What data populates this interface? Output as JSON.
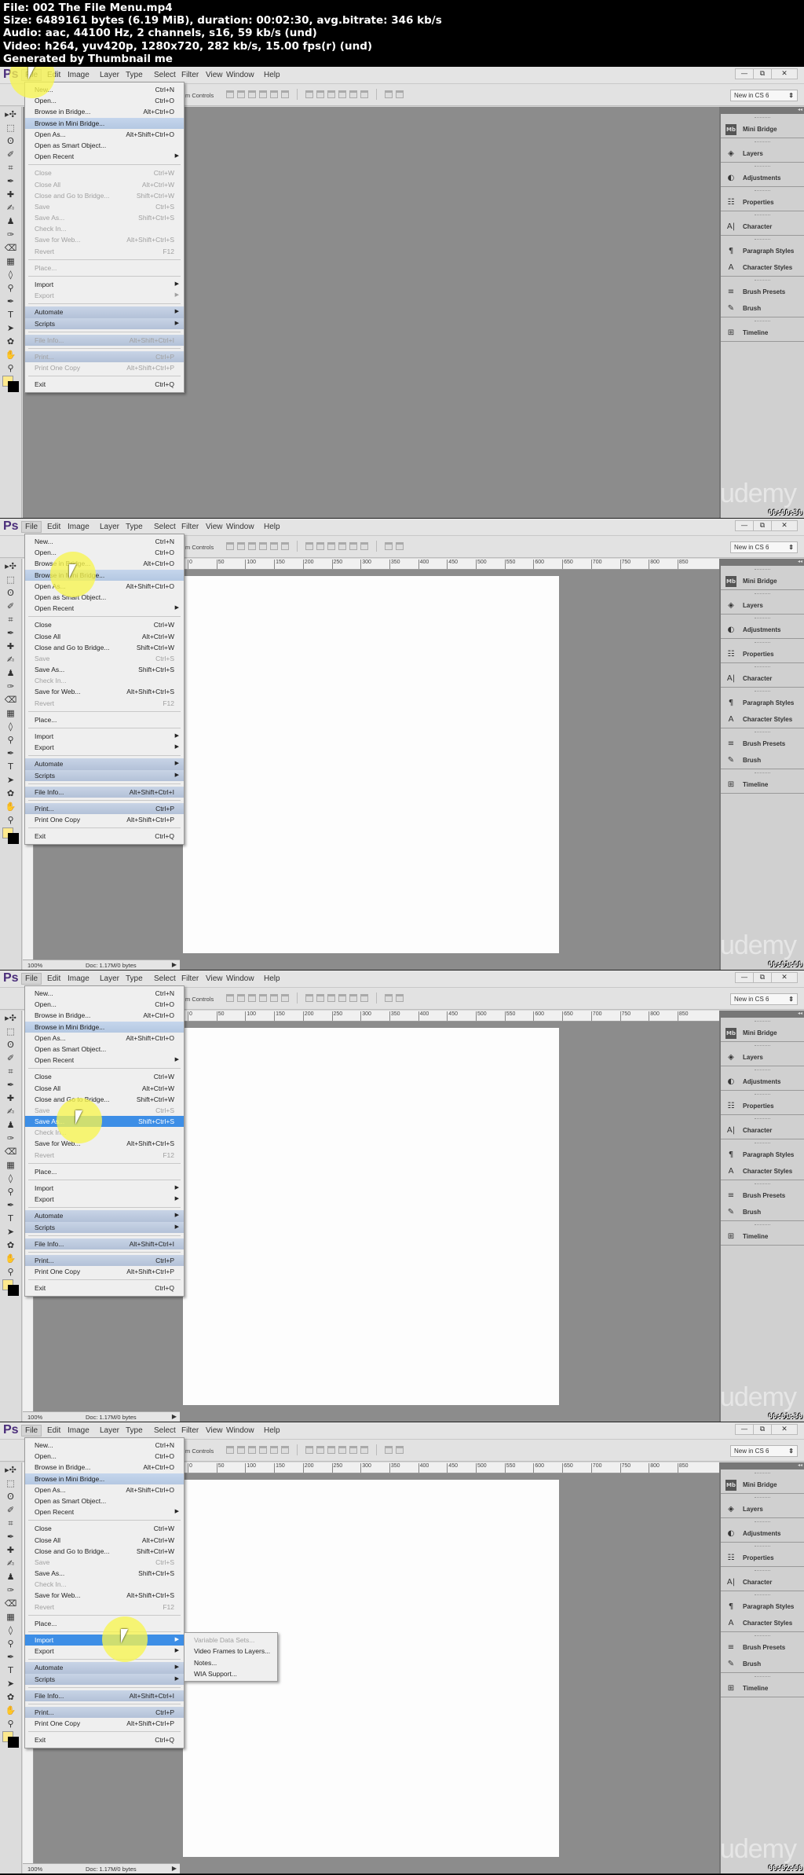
{
  "video_info": {
    "lines": [
      "File: 002 The File Menu.mp4",
      "Size: 6489161 bytes (6.19 MiB), duration: 00:02:30, avg.bitrate: 346 kb/s",
      "Audio: aac, 44100 Hz, 2 channels, s16, 59 kb/s (und)",
      "Video: h264, yuv420p, 1280x720, 282 kb/s, 15.00 fps(r) (und)",
      "Generated by Thumbnail me"
    ]
  },
  "app": {
    "logo": "Ps",
    "menubar": [
      "File",
      "Edit",
      "Image",
      "Layer",
      "Type",
      "Select",
      "Filter",
      "View",
      "Window",
      "Help"
    ],
    "window_controls": {
      "minimize": "—",
      "restore": "⧉",
      "close": "✕"
    },
    "options_label": "m Controls",
    "workspace": "New in CS 6",
    "workspace_arrow": "⇕",
    "dock_collapse": "◂◂",
    "panels": [
      {
        "group": [
          {
            "icon": "Mb",
            "icon_name": "mini-bridge-icon",
            "label": "Mini Bridge"
          }
        ]
      },
      {
        "group": [
          {
            "icon": "◈",
            "icon_name": "layers-icon",
            "label": "Layers"
          }
        ]
      },
      {
        "group": [
          {
            "icon": "◐",
            "icon_name": "adjustments-icon",
            "label": "Adjustments"
          }
        ]
      },
      {
        "group": [
          {
            "icon": "☷",
            "icon_name": "properties-icon",
            "label": "Properties"
          }
        ]
      },
      {
        "group": [
          {
            "icon": "A|",
            "icon_name": "character-icon",
            "label": "Character"
          }
        ]
      },
      {
        "group": [
          {
            "icon": "¶",
            "icon_name": "paragraph-styles-icon",
            "label": "Paragraph Styles"
          },
          {
            "icon": "A",
            "icon_name": "character-styles-icon",
            "label": "Character Styles"
          }
        ]
      },
      {
        "group": [
          {
            "icon": "≡",
            "icon_name": "brush-presets-icon",
            "label": "Brush Presets"
          },
          {
            "icon": "✎",
            "icon_name": "brush-icon",
            "label": "Brush"
          }
        ]
      },
      {
        "group": [
          {
            "icon": "⊞",
            "icon_name": "timeline-icon",
            "label": "Timeline"
          }
        ]
      }
    ],
    "tools": [
      "▸✣",
      "⬚",
      "ʘ",
      "✐",
      "⌗",
      "✒",
      "✚",
      "✍",
      "♟",
      "✑",
      "⌫",
      "▦",
      "◊",
      "⚲",
      "✒",
      "T",
      "➤",
      "✿",
      "✋",
      "⚲"
    ],
    "ruler_ticks": [
      "0",
      "50",
      "100",
      "150",
      "200",
      "250",
      "300",
      "350",
      "400",
      "450",
      "500",
      "550",
      "600",
      "650",
      "700",
      "750",
      "800",
      "850"
    ],
    "status": {
      "zoom": "100%",
      "doc": "Doc: 1.17M/0 bytes",
      "arrow": "▶"
    },
    "watermark": "udemy",
    "submenu_arrow": "▶"
  },
  "file_menu": [
    {
      "label": "New...",
      "shortcut": "Ctrl+N"
    },
    {
      "label": "Open...",
      "shortcut": "Ctrl+O"
    },
    {
      "label": "Browse in Bridge...",
      "shortcut": "Alt+Ctrl+O"
    },
    {
      "label": "Browse in Mini Bridge...",
      "shortcut": ""
    },
    {
      "label": "Open As...",
      "shortcut": "Alt+Shift+Ctrl+O"
    },
    {
      "label": "Open as Smart Object...",
      "shortcut": ""
    },
    {
      "label": "Open Recent",
      "shortcut": "",
      "submenu": true
    },
    {
      "sep": true
    },
    {
      "label": "Close",
      "shortcut": "Ctrl+W"
    },
    {
      "label": "Close All",
      "shortcut": "Alt+Ctrl+W"
    },
    {
      "label": "Close and Go to Bridge...",
      "shortcut": "Shift+Ctrl+W"
    },
    {
      "label": "Save",
      "shortcut": "Ctrl+S"
    },
    {
      "label": "Save As...",
      "shortcut": "Shift+Ctrl+S"
    },
    {
      "label": "Check In...",
      "shortcut": ""
    },
    {
      "label": "Save for Web...",
      "shortcut": "Alt+Shift+Ctrl+S"
    },
    {
      "label": "Revert",
      "shortcut": "F12"
    },
    {
      "sep": true
    },
    {
      "label": "Place...",
      "shortcut": ""
    },
    {
      "sep": true
    },
    {
      "label": "Import",
      "shortcut": "",
      "submenu": true
    },
    {
      "label": "Export",
      "shortcut": "",
      "submenu": true
    },
    {
      "sep": true
    },
    {
      "label": "Automate",
      "shortcut": "",
      "submenu": true
    },
    {
      "label": "Scripts",
      "shortcut": "",
      "submenu": true
    },
    {
      "sep": true
    },
    {
      "label": "File Info...",
      "shortcut": "Alt+Shift+Ctrl+I"
    },
    {
      "sep": true
    },
    {
      "label": "Print...",
      "shortcut": "Ctrl+P"
    },
    {
      "label": "Print One Copy",
      "shortcut": "Alt+Shift+Ctrl+P"
    },
    {
      "sep": true
    },
    {
      "label": "Exit",
      "shortcut": "Ctrl+Q"
    }
  ],
  "import_submenu": [
    {
      "label": "Variable Data Sets...",
      "disabled": true
    },
    {
      "label": "Video Frames to Layers...",
      "disabled": false
    },
    {
      "label": "Notes...",
      "disabled": false
    },
    {
      "label": "WIA Support...",
      "disabled": false
    }
  ],
  "frames": [
    {
      "timestamp": "00:00:30",
      "has_document": false,
      "disabled": [
        "Close",
        "Close All",
        "Close and Go to Bridge...",
        "Save",
        "Save As...",
        "Check In...",
        "Save for Web...",
        "Revert",
        "Place...",
        "Export",
        "File Info...",
        "Print...",
        "Print One Copy"
      ],
      "highlighted": [
        "Browse in Mini Bridge..."
      ],
      "selected": [],
      "group_shaded": [
        "Automate",
        "Scripts",
        "File Info...",
        "Print..."
      ],
      "cursor_near": "File",
      "show_import_submenu": false
    },
    {
      "timestamp": "00:01:00",
      "has_document": true,
      "disabled": [
        "Save",
        "Check In...",
        "Revert"
      ],
      "highlighted": [
        "Browse in Mini Bridge..."
      ],
      "selected": [],
      "group_shaded": [
        "Automate",
        "Scripts",
        "File Info...",
        "Print..."
      ],
      "cursor_near": "Browse in Mini Bridge...",
      "show_import_submenu": false
    },
    {
      "timestamp": "00:01:30",
      "has_document": true,
      "disabled": [
        "Save",
        "Check In...",
        "Revert"
      ],
      "highlighted": [
        "Browse in Mini Bridge..."
      ],
      "selected": [
        "Save As..."
      ],
      "group_shaded": [
        "Automate",
        "Scripts",
        "File Info...",
        "Print..."
      ],
      "cursor_near": "Save As...",
      "show_import_submenu": false
    },
    {
      "timestamp": "00:02:00",
      "has_document": true,
      "disabled": [
        "Save",
        "Check In...",
        "Revert"
      ],
      "highlighted": [
        "Browse in Mini Bridge..."
      ],
      "selected": [
        "Import"
      ],
      "group_shaded": [
        "Automate",
        "Scripts",
        "File Info...",
        "Print..."
      ],
      "cursor_near": "Import",
      "show_import_submenu": true
    }
  ]
}
